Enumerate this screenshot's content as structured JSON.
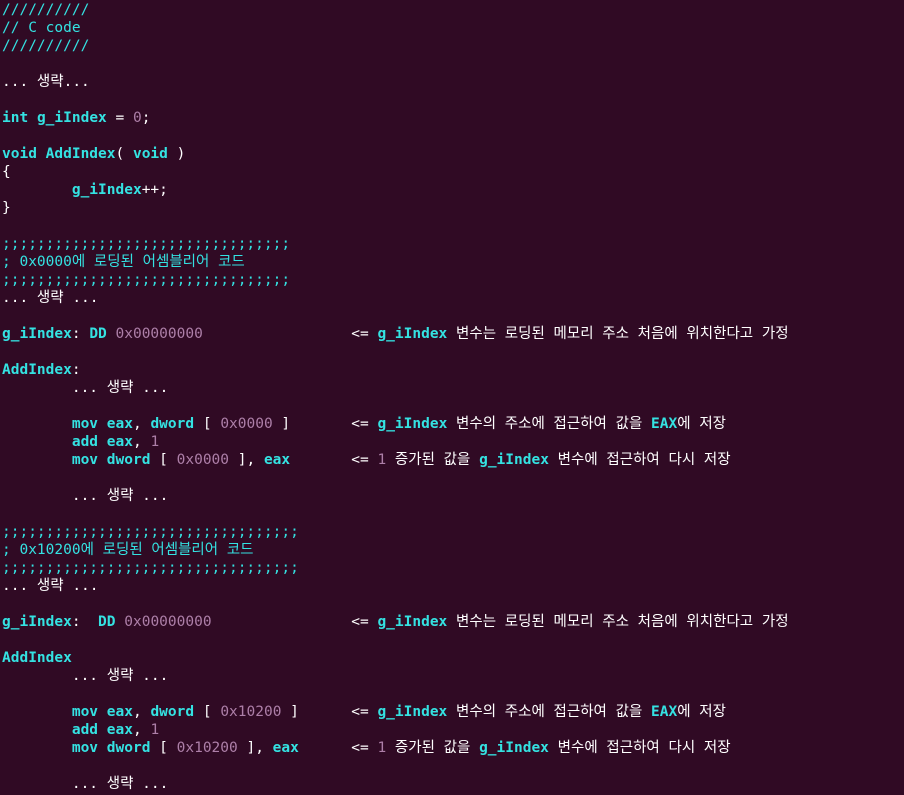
{
  "window": {
    "title": "code-editor"
  },
  "colors": {
    "background": "#300a24",
    "default_text": "#ffffff",
    "comment": "#34e2e2",
    "keyword": "#34e2e2",
    "identifier": "#34e2e2",
    "number": "#ad7fa8"
  },
  "lines": [
    [
      {
        "t": "//////////",
        "c": "comment"
      }
    ],
    [
      {
        "t": "// C code",
        "c": "comment"
      }
    ],
    [
      {
        "t": "//////////",
        "c": "comment"
      }
    ],
    [],
    [
      {
        "t": "... 생략...",
        "c": "text"
      }
    ],
    [],
    [
      {
        "t": "int",
        "c": "kw"
      },
      {
        "t": " ",
        "c": "text"
      },
      {
        "t": "g_iIndex",
        "c": "ident"
      },
      {
        "t": " = ",
        "c": "text"
      },
      {
        "t": "0",
        "c": "num"
      },
      {
        "t": ";",
        "c": "text"
      }
    ],
    [],
    [
      {
        "t": "void",
        "c": "kw"
      },
      {
        "t": " ",
        "c": "text"
      },
      {
        "t": "AddIndex",
        "c": "ident"
      },
      {
        "t": "( ",
        "c": "text"
      },
      {
        "t": "void",
        "c": "kw"
      },
      {
        "t": " )",
        "c": "text"
      }
    ],
    [
      {
        "t": "{",
        "c": "text"
      }
    ],
    [
      {
        "t": "        ",
        "c": "text"
      },
      {
        "t": "g_iIndex",
        "c": "ident"
      },
      {
        "t": "++;",
        "c": "text"
      }
    ],
    [
      {
        "t": "}",
        "c": "text"
      }
    ],
    [],
    [
      {
        "t": ";;;;;;;;;;;;;;;;;;;;;;;;;;;;;;;;;",
        "c": "comment"
      }
    ],
    [
      {
        "t": "; 0x0000에 로딩된 어셈블리어 코드",
        "c": "comment"
      }
    ],
    [
      {
        "t": ";;;;;;;;;;;;;;;;;;;;;;;;;;;;;;;;;",
        "c": "comment"
      }
    ],
    [
      {
        "t": "... 생략 ...",
        "c": "text"
      }
    ],
    [],
    [
      {
        "t": "g_iIndex",
        "c": "ident"
      },
      {
        "t": ": ",
        "c": "text"
      },
      {
        "t": "DD",
        "c": "kw"
      },
      {
        "t": " ",
        "c": "text"
      },
      {
        "t": "0x00000000",
        "c": "num"
      },
      {
        "t": "                 <= ",
        "c": "text"
      },
      {
        "t": "g_iIndex",
        "c": "ident"
      },
      {
        "t": " 변수는 로딩된 메모리 주소 처음에 위치한다고 가정",
        "c": "text"
      }
    ],
    [],
    [
      {
        "t": "AddIndex",
        "c": "ident"
      },
      {
        "t": ":",
        "c": "text"
      }
    ],
    [
      {
        "t": "        ... 생략 ...",
        "c": "text"
      }
    ],
    [],
    [
      {
        "t": "        ",
        "c": "text"
      },
      {
        "t": "mov",
        "c": "kw"
      },
      {
        "t": " ",
        "c": "text"
      },
      {
        "t": "eax",
        "c": "kw"
      },
      {
        "t": ", ",
        "c": "text"
      },
      {
        "t": "dword",
        "c": "kw"
      },
      {
        "t": " [ ",
        "c": "text"
      },
      {
        "t": "0x0000",
        "c": "num"
      },
      {
        "t": " ]       <= ",
        "c": "text"
      },
      {
        "t": "g_iIndex",
        "c": "ident"
      },
      {
        "t": " 변수의 주소에 접근하여 값을 ",
        "c": "text"
      },
      {
        "t": "EAX",
        "c": "kw"
      },
      {
        "t": "에 저장",
        "c": "text"
      }
    ],
    [
      {
        "t": "        ",
        "c": "text"
      },
      {
        "t": "add",
        "c": "kw"
      },
      {
        "t": " ",
        "c": "text"
      },
      {
        "t": "eax",
        "c": "kw"
      },
      {
        "t": ", ",
        "c": "text"
      },
      {
        "t": "1",
        "c": "num"
      }
    ],
    [
      {
        "t": "        ",
        "c": "text"
      },
      {
        "t": "mov",
        "c": "kw"
      },
      {
        "t": " ",
        "c": "text"
      },
      {
        "t": "dword",
        "c": "kw"
      },
      {
        "t": " [ ",
        "c": "text"
      },
      {
        "t": "0x0000",
        "c": "num"
      },
      {
        "t": " ], ",
        "c": "text"
      },
      {
        "t": "eax",
        "c": "kw"
      },
      {
        "t": "       <= ",
        "c": "text"
      },
      {
        "t": "1",
        "c": "num"
      },
      {
        "t": " 증가된 값을 ",
        "c": "text"
      },
      {
        "t": "g_iIndex",
        "c": "ident"
      },
      {
        "t": " 변수에 접근하여 다시 저장",
        "c": "text"
      }
    ],
    [],
    [
      {
        "t": "        ... 생략 ...",
        "c": "text"
      }
    ],
    [],
    [
      {
        "t": ";;;;;;;;;;;;;;;;;;;;;;;;;;;;;;;;;;",
        "c": "comment"
      }
    ],
    [
      {
        "t": "; 0x10200에 로딩된 어셈블리어 코드",
        "c": "comment"
      }
    ],
    [
      {
        "t": ";;;;;;;;;;;;;;;;;;;;;;;;;;;;;;;;;;",
        "c": "comment"
      }
    ],
    [
      {
        "t": "... 생략 ...",
        "c": "text"
      }
    ],
    [],
    [
      {
        "t": "g_iIndex",
        "c": "ident"
      },
      {
        "t": ":  ",
        "c": "text"
      },
      {
        "t": "DD",
        "c": "kw"
      },
      {
        "t": " ",
        "c": "text"
      },
      {
        "t": "0x00000000",
        "c": "num"
      },
      {
        "t": "                <= ",
        "c": "text"
      },
      {
        "t": "g_iIndex",
        "c": "ident"
      },
      {
        "t": " 변수는 로딩된 메모리 주소 처음에 위치한다고 가정",
        "c": "text"
      }
    ],
    [],
    [
      {
        "t": "AddIndex",
        "c": "ident"
      }
    ],
    [
      {
        "t": "        ... 생략 ...",
        "c": "text"
      }
    ],
    [],
    [
      {
        "t": "        ",
        "c": "text"
      },
      {
        "t": "mov",
        "c": "kw"
      },
      {
        "t": " ",
        "c": "text"
      },
      {
        "t": "eax",
        "c": "kw"
      },
      {
        "t": ", ",
        "c": "text"
      },
      {
        "t": "dword",
        "c": "kw"
      },
      {
        "t": " [ ",
        "c": "text"
      },
      {
        "t": "0x10200",
        "c": "num"
      },
      {
        "t": " ]      <= ",
        "c": "text"
      },
      {
        "t": "g_iIndex",
        "c": "ident"
      },
      {
        "t": " 변수의 주소에 접근하여 값을 ",
        "c": "text"
      },
      {
        "t": "EAX",
        "c": "kw"
      },
      {
        "t": "에 저장",
        "c": "text"
      }
    ],
    [
      {
        "t": "        ",
        "c": "text"
      },
      {
        "t": "add",
        "c": "kw"
      },
      {
        "t": " ",
        "c": "text"
      },
      {
        "t": "eax",
        "c": "kw"
      },
      {
        "t": ", ",
        "c": "text"
      },
      {
        "t": "1",
        "c": "num"
      }
    ],
    [
      {
        "t": "        ",
        "c": "text"
      },
      {
        "t": "mov",
        "c": "kw"
      },
      {
        "t": " ",
        "c": "text"
      },
      {
        "t": "dword",
        "c": "kw"
      },
      {
        "t": " [ ",
        "c": "text"
      },
      {
        "t": "0x10200",
        "c": "num"
      },
      {
        "t": " ], ",
        "c": "text"
      },
      {
        "t": "eax",
        "c": "kw"
      },
      {
        "t": "      <= ",
        "c": "text"
      },
      {
        "t": "1",
        "c": "num"
      },
      {
        "t": " 증가된 값을 ",
        "c": "text"
      },
      {
        "t": "g_iIndex",
        "c": "ident"
      },
      {
        "t": " 변수에 접근하여 다시 저장",
        "c": "text"
      }
    ],
    [],
    [
      {
        "t": "        ... 생략 ...",
        "c": "text"
      }
    ]
  ]
}
